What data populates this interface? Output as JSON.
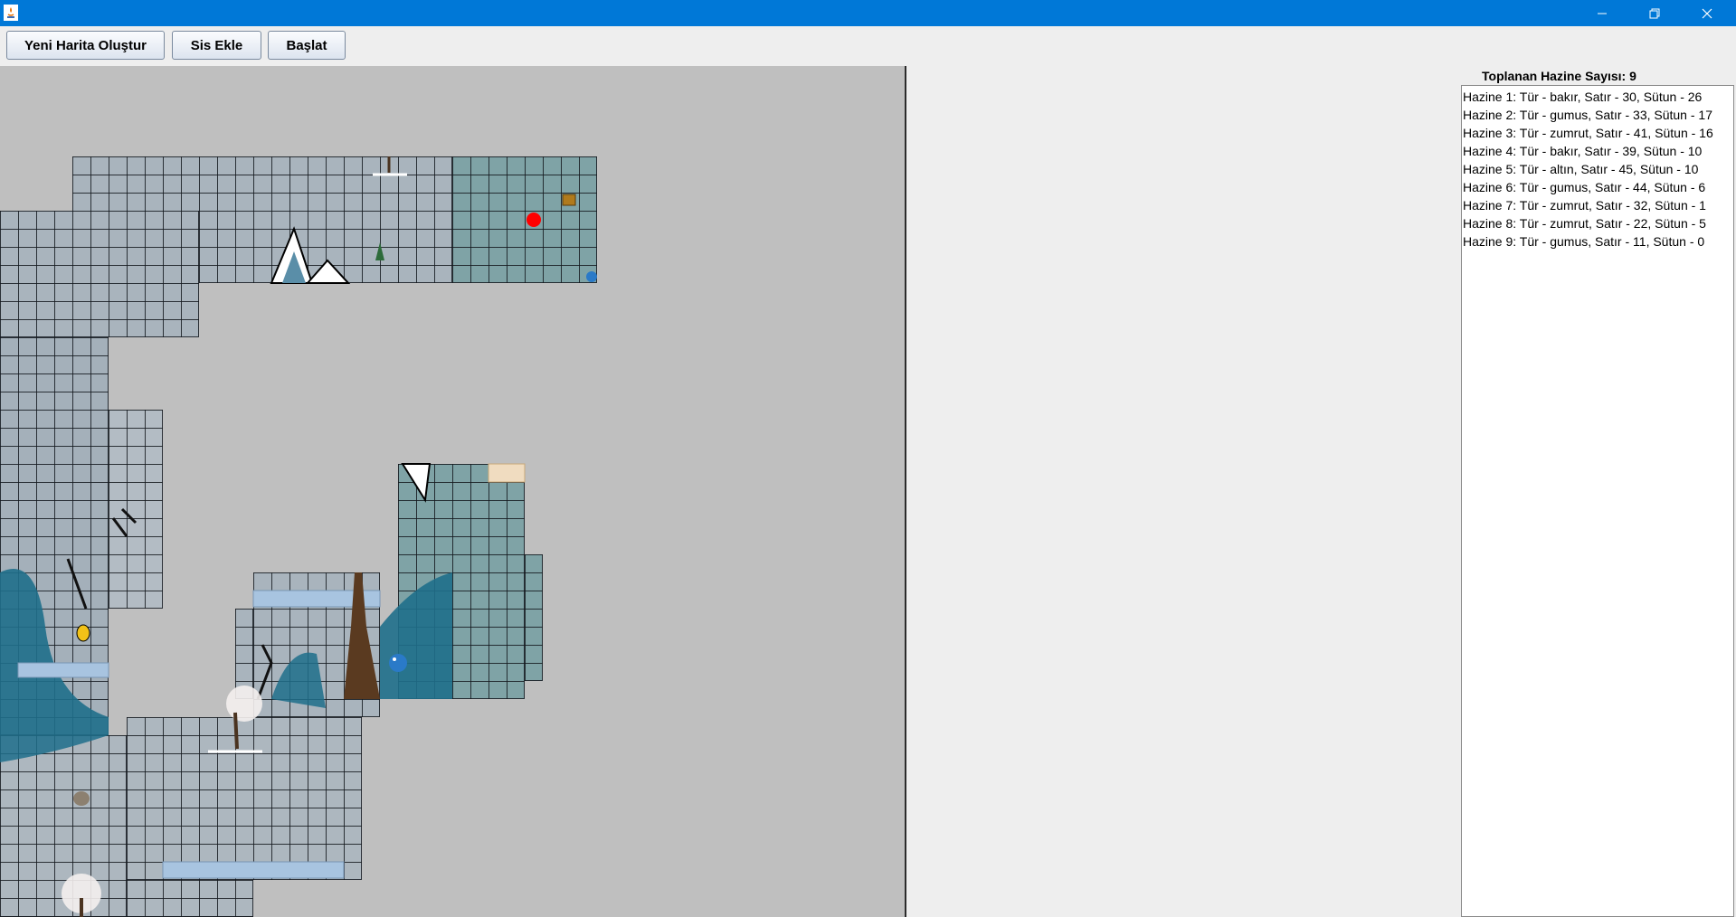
{
  "window": {
    "title": "",
    "controls": [
      "minimize-icon",
      "restore-icon",
      "close-icon"
    ]
  },
  "toolbar": {
    "new_map_label": "Yeni Harita Oluştur",
    "add_fog_label": "Sis Ekle",
    "start_label": "Başlat"
  },
  "sidebar": {
    "count_label": "Toplanan Hazine Sayısı: 9",
    "items": [
      "Hazine 1: Tür - bakır, Satır - 30, Sütun - 26",
      "Hazine 2: Tür - gumus, Satır - 33, Sütun - 17",
      "Hazine 3: Tür - zumrut, Satır - 41, Sütun - 16",
      "Hazine 4: Tür - bakır, Satır - 39, Sütun - 10",
      "Hazine 5: Tür - altın, Satır - 45, Sütun - 10",
      "Hazine 6: Tür - gumus, Satır - 44, Sütun - 6",
      "Hazine 7: Tür - zumrut, Satır - 32, Sütun - 1",
      "Hazine 8: Tür - zumrut, Satır - 22, Sütun - 5",
      "Hazine 9: Tür - gumus, Satır - 11, Sütun - 0"
    ]
  },
  "colors": {
    "titlebar": "#0078d7",
    "fog": "#bfbfbf",
    "revealed_snow": "#a9b4bd",
    "revealed_ice": "#7fa3a6",
    "player": "#ff0000",
    "ice_blue": "#1f6f8b"
  },
  "map": {
    "player_icon": "red-dot-player",
    "objects": [
      "mountain-icon",
      "tree-icon",
      "bird-icon",
      "bee-icon",
      "rock-icon",
      "ice-wall-icon",
      "snow-tree-icon",
      "chest-icon"
    ]
  }
}
